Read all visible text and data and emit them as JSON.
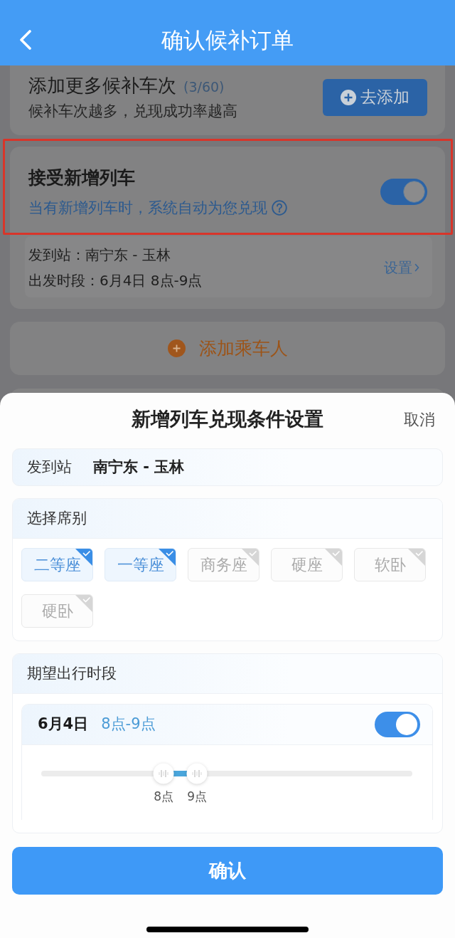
{
  "header": {
    "title": "确认候补订单"
  },
  "more_trains": {
    "title": "添加更多候补车次",
    "count": "(3/60)",
    "subtitle": "候补车次越多，兑现成功率越高",
    "button": "去添加"
  },
  "new_trains": {
    "title": "接受新增列车",
    "subtitle": "当有新增列车时，系统自动为您兑现",
    "on": true,
    "highlighted": true,
    "route": "发到站：南宁东 - 玉林",
    "period": "出发时段：6月4日 8点-9点",
    "settings_link": "设置"
  },
  "add_passenger": {
    "label": "添加乘车人"
  },
  "sheet": {
    "title": "新增列车兑现条件设置",
    "cancel": "取消",
    "station": {
      "label": "发到站",
      "value": "南宁东 - 玉林"
    },
    "seats": {
      "title": "选择席别",
      "options": [
        {
          "label": "二等座",
          "selected": true
        },
        {
          "label": "一等座",
          "selected": true
        },
        {
          "label": "商务座",
          "selected": false
        },
        {
          "label": "硬座",
          "selected": false
        },
        {
          "label": "软卧",
          "selected": false
        },
        {
          "label": "硬卧",
          "selected": false
        }
      ]
    },
    "time": {
      "title": "期望出行时段",
      "days": [
        {
          "date": "6月4日",
          "range": "8点-9点",
          "on": true,
          "thumbs": [
            {
              "level": 0.33,
              "label": "8点"
            },
            {
              "level": 0.42,
              "label": "9点"
            }
          ]
        }
      ]
    },
    "confirm": "确认"
  }
}
